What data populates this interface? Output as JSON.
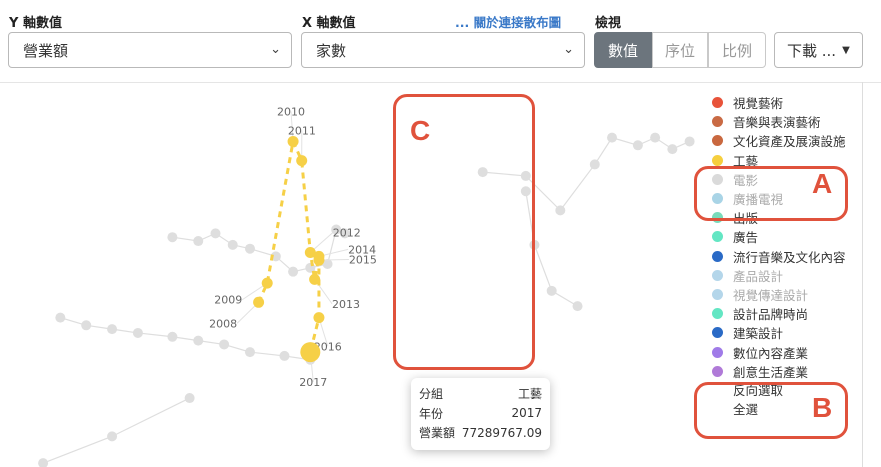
{
  "controls": {
    "y_label": "Y 軸數值",
    "y_value": "營業額",
    "x_label": "X 軸數值",
    "x_value": "家數",
    "about_link": "... 關於連接散布圖",
    "view_label": "檢視",
    "view_options": [
      "數值",
      "序位",
      "比例"
    ],
    "view_active": "數值",
    "download_label": "下載 ..."
  },
  "legend": {
    "items": [
      {
        "label": "視覺藝術",
        "color": "#e8533a",
        "dim": false
      },
      {
        "label": "音樂與表演藝術",
        "color": "#c96a44",
        "dim": false
      },
      {
        "label": "文化資產及展演設施",
        "color": "#c9683f",
        "dim": false
      },
      {
        "label": "工藝",
        "color": "#f6cf3e",
        "dim": false
      },
      {
        "label": "電影",
        "color": "#dadada",
        "dim": true
      },
      {
        "label": "廣播電視",
        "color": "#a9d4e6",
        "dim": true
      },
      {
        "label": "出版",
        "color": "#79dbbb",
        "dim": false
      },
      {
        "label": "廣告",
        "color": "#63e6c3",
        "dim": false
      },
      {
        "label": "流行音樂及文化內容",
        "color": "#2a6ac6",
        "dim": false
      },
      {
        "label": "產品設計",
        "color": "#b4d6ea",
        "dim": true
      },
      {
        "label": "視覺傳達設計",
        "color": "#b4d6ea",
        "dim": true
      },
      {
        "label": "設計品牌時尚",
        "color": "#63e6c3",
        "dim": false
      },
      {
        "label": "建築設計",
        "color": "#2a6ac6",
        "dim": false
      },
      {
        "label": "數位內容產業",
        "color": "#a07be8",
        "dim": false
      },
      {
        "label": "創意生活產業",
        "color": "#b07ad8",
        "dim": false
      }
    ],
    "invert_label": "反向選取",
    "select_all_label": "全選"
  },
  "tooltip": {
    "rows": [
      {
        "key": "分組",
        "value": "工藝"
      },
      {
        "key": "年份",
        "value": "2017"
      },
      {
        "key": "營業額",
        "value": "77289767.09"
      }
    ]
  },
  "annotations": {
    "a": "A",
    "b": "B",
    "c": "C"
  },
  "chart_data": {
    "type": "scatter",
    "title": "",
    "xlabel": "家數",
    "ylabel": "營業額",
    "highlight_color": "#f6d047",
    "background_color": "#dedede",
    "highlight_series": {
      "name": "工藝",
      "points": [
        {
          "label": "2008",
          "x": 0.3,
          "y": 0.43
        },
        {
          "label": "2009",
          "x": 0.31,
          "y": 0.48
        },
        {
          "label": "2010",
          "x": 0.34,
          "y": 0.85
        },
        {
          "label": "2011",
          "x": 0.35,
          "y": 0.8
        },
        {
          "label": "2012",
          "x": 0.36,
          "y": 0.56
        },
        {
          "label": "2013",
          "x": 0.365,
          "y": 0.49
        },
        {
          "label": "2014",
          "x": 0.37,
          "y": 0.55
        },
        {
          "label": "2015",
          "x": 0.37,
          "y": 0.54
        },
        {
          "label": "2016",
          "x": 0.37,
          "y": 0.39
        },
        {
          "label": "2017",
          "x": 0.36,
          "y": 0.3
        }
      ]
    },
    "background_series": [
      {
        "points": [
          [
            0.07,
            0.39
          ],
          [
            0.1,
            0.37
          ],
          [
            0.13,
            0.36
          ],
          [
            0.16,
            0.35
          ],
          [
            0.2,
            0.34
          ],
          [
            0.23,
            0.33
          ],
          [
            0.26,
            0.32
          ],
          [
            0.29,
            0.3
          ],
          [
            0.33,
            0.29
          ],
          [
            0.36,
            0.28
          ]
        ]
      },
      {
        "points": [
          [
            0.2,
            0.6
          ],
          [
            0.23,
            0.59
          ],
          [
            0.25,
            0.61
          ],
          [
            0.27,
            0.58
          ],
          [
            0.29,
            0.57
          ],
          [
            0.32,
            0.55
          ],
          [
            0.34,
            0.51
          ],
          [
            0.36,
            0.52
          ],
          [
            0.38,
            0.53
          ],
          [
            0.39,
            0.62
          ],
          [
            0.4,
            0.61
          ]
        ]
      },
      {
        "points": [
          [
            0.56,
            0.77
          ],
          [
            0.61,
            0.76
          ],
          [
            0.65,
            0.67
          ],
          [
            0.69,
            0.79
          ],
          [
            0.71,
            0.86
          ],
          [
            0.74,
            0.84
          ],
          [
            0.76,
            0.86
          ],
          [
            0.78,
            0.83
          ],
          [
            0.8,
            0.85
          ]
        ]
      },
      {
        "points": [
          [
            0.61,
            0.72
          ],
          [
            0.62,
            0.58
          ],
          [
            0.64,
            0.46
          ],
          [
            0.67,
            0.42
          ]
        ]
      },
      {
        "points": [
          [
            0.05,
            0.01
          ],
          [
            0.13,
            0.08
          ],
          [
            0.22,
            0.18
          ]
        ]
      }
    ]
  }
}
